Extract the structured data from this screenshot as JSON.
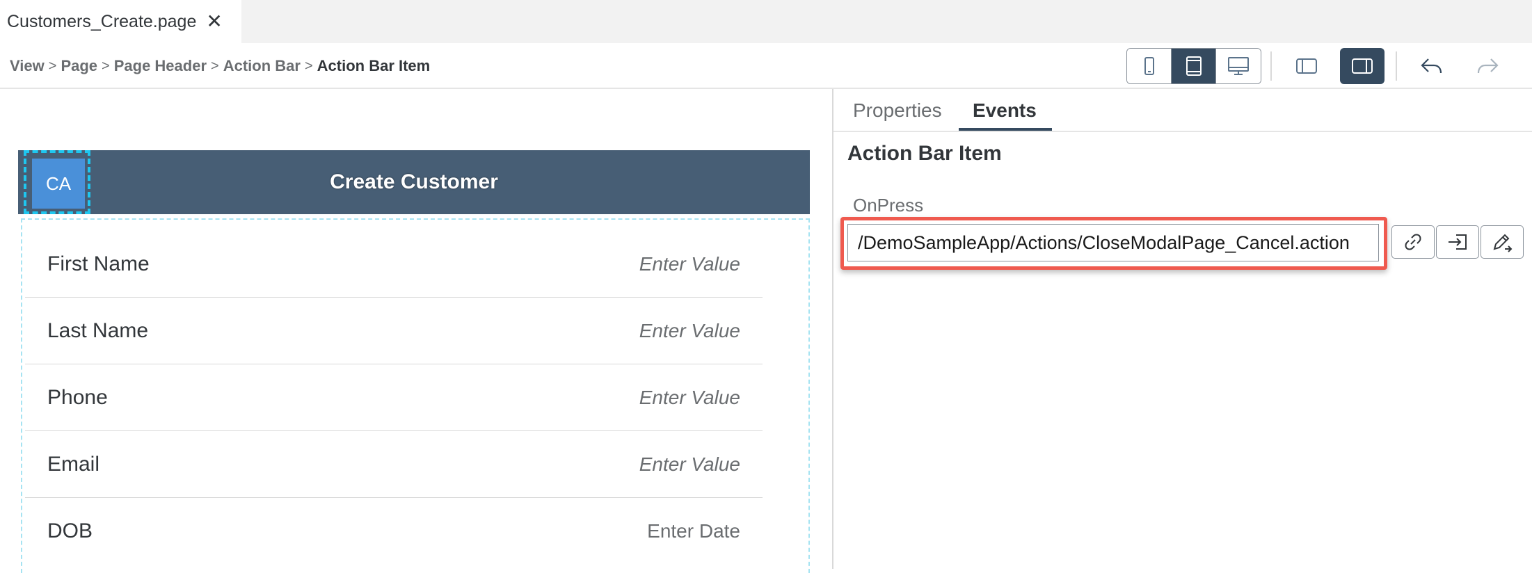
{
  "tab": {
    "title": "Customers_Create.page",
    "close_glyph": "✕"
  },
  "breadcrumb": {
    "items": [
      "View",
      "Page",
      "Page Header",
      "Action Bar",
      "Action Bar Item"
    ],
    "separator": ">"
  },
  "toolbar": {
    "device_buttons": [
      "phone-icon",
      "tablet-icon",
      "desktop-icon"
    ],
    "active_device": "tablet-icon",
    "panel_buttons": [
      "left-panel-icon",
      "right-panel-icon"
    ],
    "active_panel": "right-panel-icon",
    "history": [
      "undo-icon",
      "redo-icon"
    ]
  },
  "canvas": {
    "header": {
      "avatar_text": "CA",
      "title": "Create Customer"
    },
    "fields": [
      {
        "label": "First Name",
        "placeholder": "Enter Value"
      },
      {
        "label": "Last Name",
        "placeholder": "Enter Value"
      },
      {
        "label": "Phone",
        "placeholder": "Enter Value"
      },
      {
        "label": "Email",
        "placeholder": "Enter Value"
      },
      {
        "label": "DOB",
        "placeholder": "Enter Date"
      }
    ]
  },
  "panel": {
    "tabs": [
      "Properties",
      "Events"
    ],
    "active_tab": "Events",
    "section_title": "Action Bar Item",
    "field_label": "OnPress",
    "field_value": "/DemoSampleApp/Actions/CloseModalPage_Cancel.action",
    "field_buttons": [
      "link-icon",
      "bind-icon",
      "edit-icon"
    ]
  },
  "colors": {
    "header_bg": "#475e75",
    "active_button": "#354a5f",
    "avatar_bg": "#4a90d9",
    "selection_outline": "#1ec7f0",
    "highlight": "#ef5a4f"
  }
}
